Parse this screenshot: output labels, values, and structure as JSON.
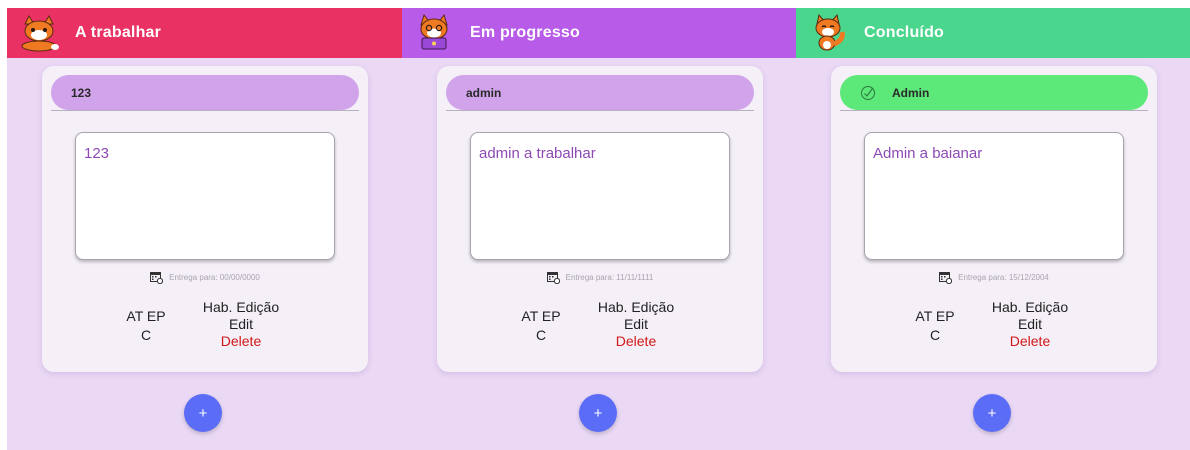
{
  "colors": {
    "board_bg": "#ead8f5",
    "todo_header": "#ea3163",
    "progress_header": "#b85be8",
    "done_header": "#4bd68d",
    "add_button": "#5b6cf6",
    "delete_text": "#d01818"
  },
  "columns": [
    {
      "title": "A trabalhar",
      "header_color": "#ea3163",
      "mascot_icon": "fox-lying-icon",
      "task": {
        "name": "123",
        "bar_color": "#d1a3ea",
        "description": "123",
        "due": "Entrega para: 00/00/0000",
        "stage_top": "AT EP",
        "stage_bottom": "C",
        "edit_toggle": "Hab. Edição",
        "edit": "Edit",
        "delete": "Delete"
      },
      "add_label": "+"
    },
    {
      "title": "Em progresso",
      "header_color": "#b85be8",
      "mascot_icon": "fox-laptop-icon",
      "task": {
        "name": "admin",
        "bar_color": "#d1a3ea",
        "description": "admin a trabalhar",
        "due": "Entrega para: 11/11/1111",
        "stage_top": "AT EP",
        "stage_bottom": "C",
        "edit_toggle": "Hab. Edição",
        "edit": "Edit",
        "delete": "Delete"
      },
      "add_label": "+"
    },
    {
      "title": "Concluído",
      "header_color": "#4bd68d",
      "mascot_icon": "fox-happy-icon",
      "task": {
        "name": "Admin",
        "bar_color": "#5de87a",
        "completed_icon": "check-circle-icon",
        "description": "Admin a baianar",
        "due": "Entrega para: 15/12/2004",
        "stage_top": "AT EP",
        "stage_bottom": "C",
        "edit_toggle": "Hab. Edição",
        "edit": "Edit",
        "delete": "Delete"
      },
      "add_label": "+"
    }
  ]
}
